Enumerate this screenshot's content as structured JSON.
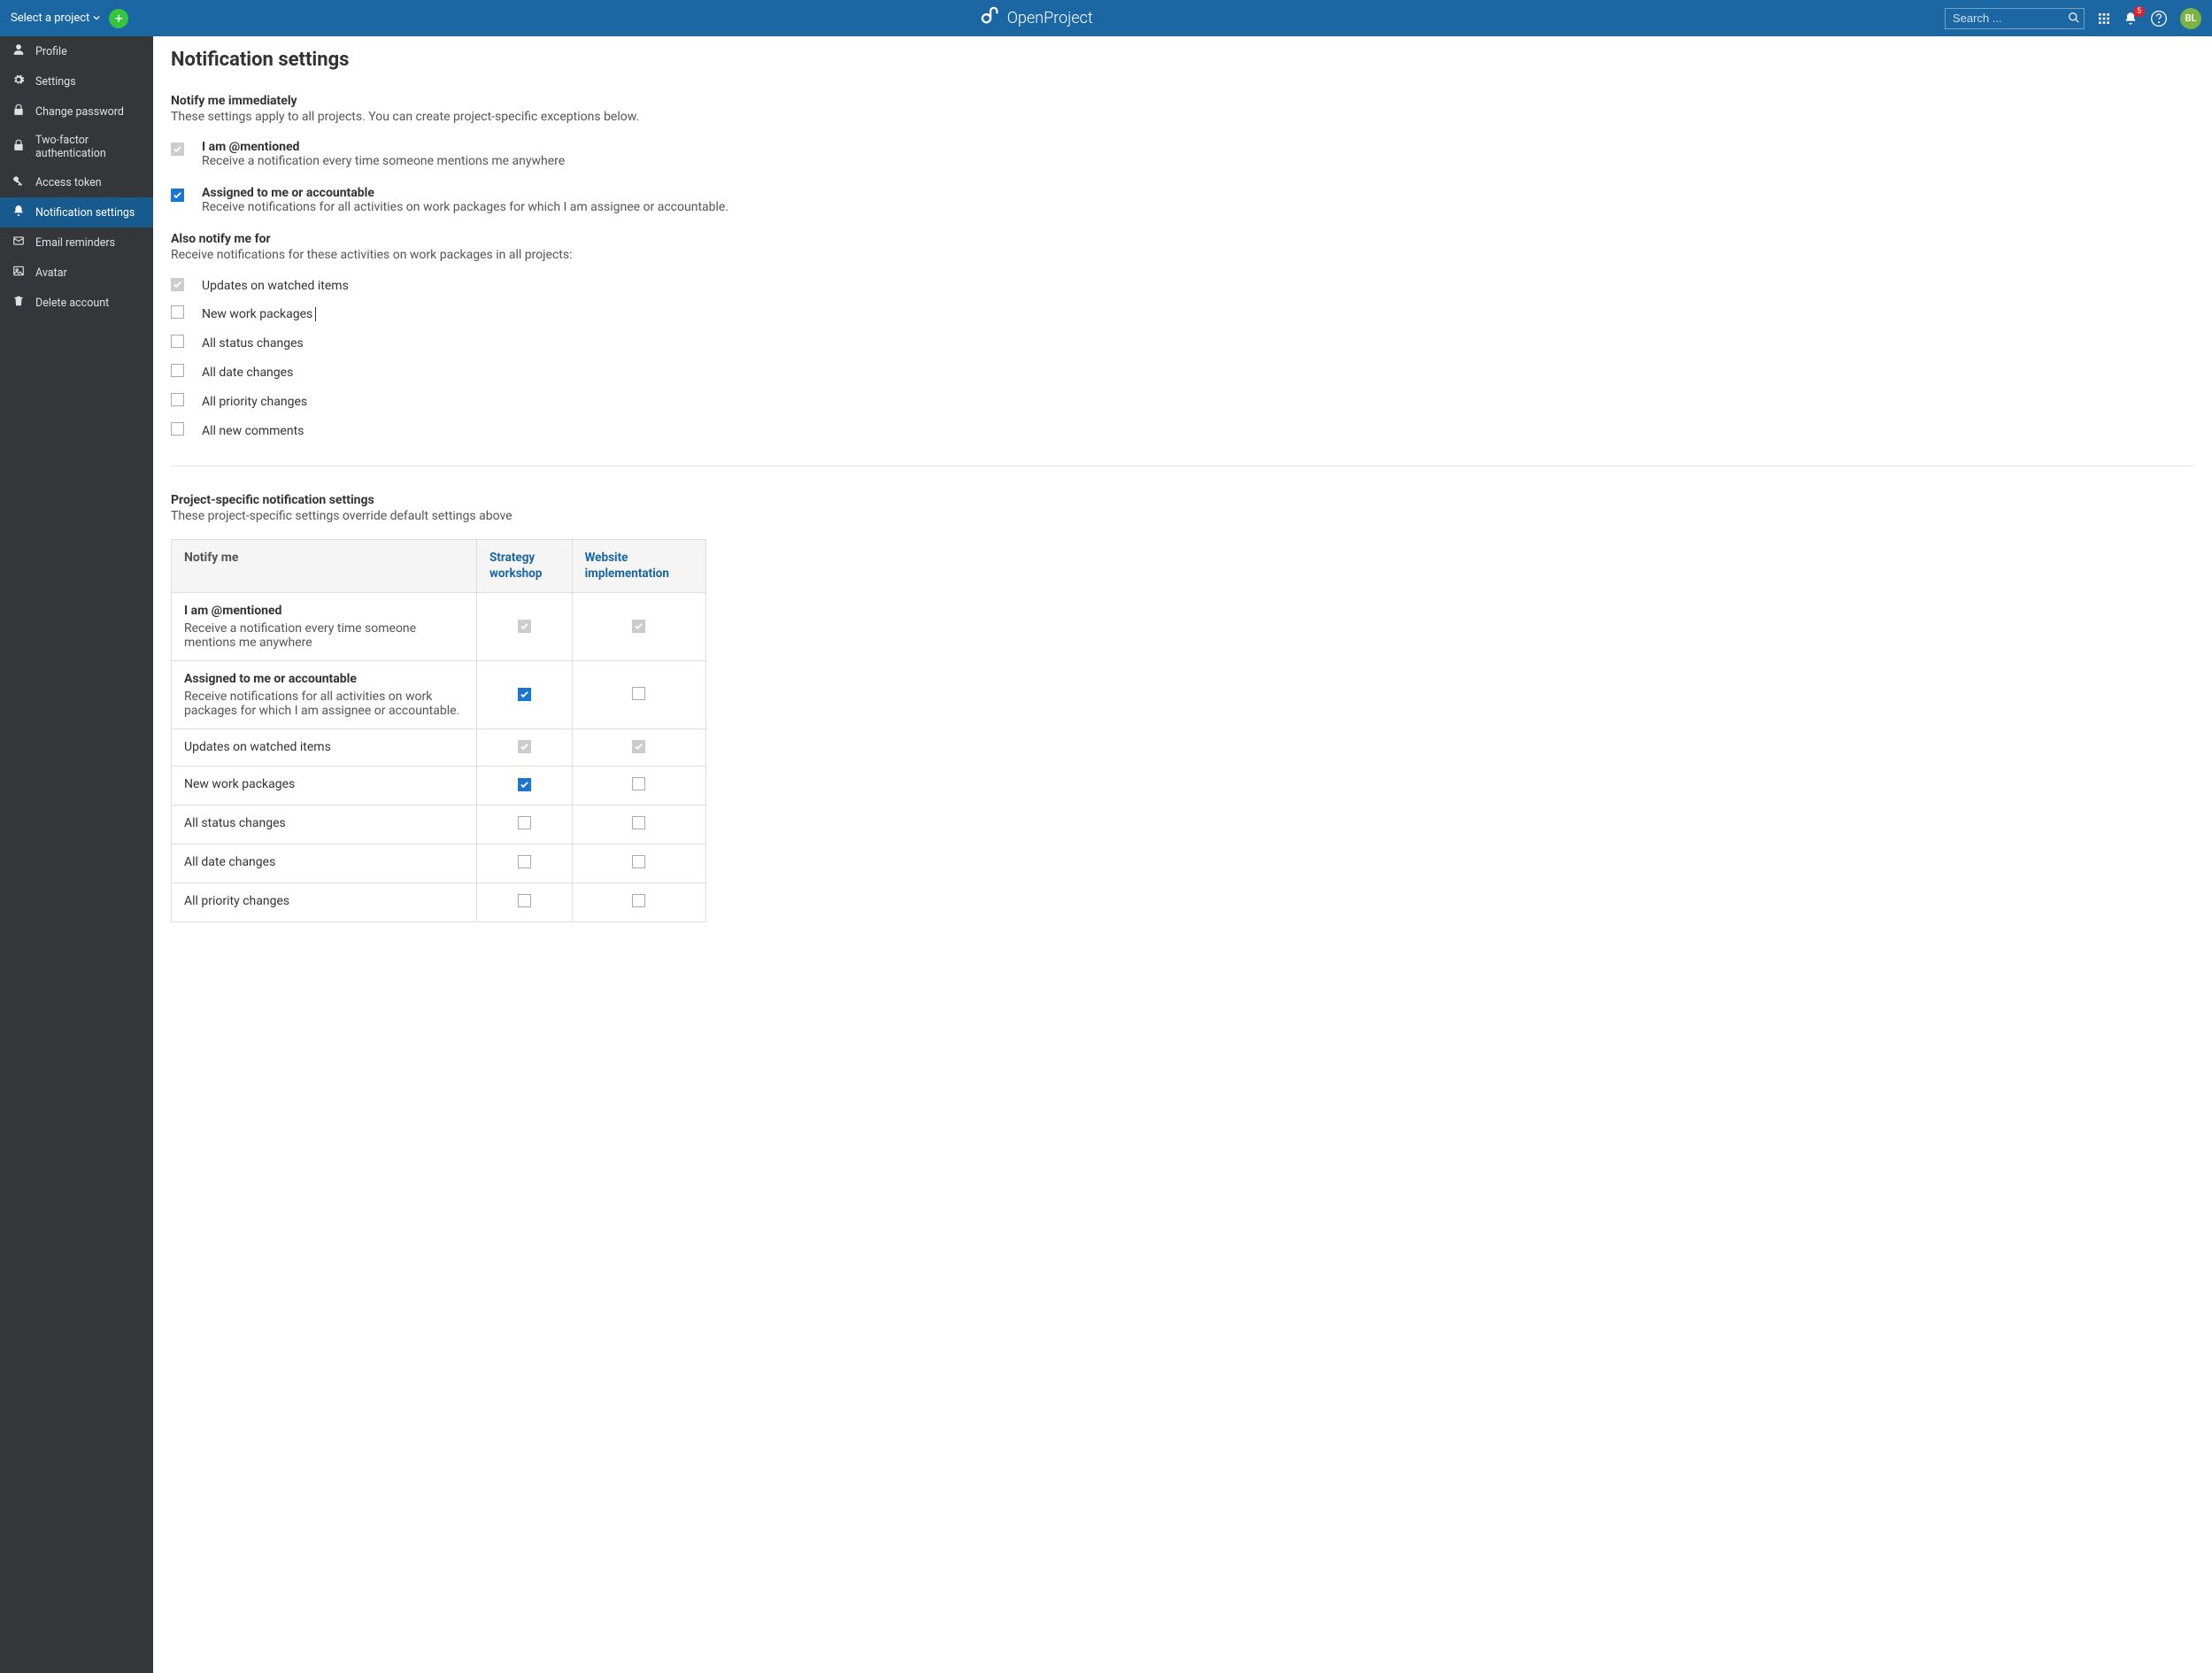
{
  "topbar": {
    "project_label": "Select a project",
    "search_placeholder": "Search ...",
    "brand": "OpenProject",
    "badge_count": "5",
    "avatar_initials": "BL"
  },
  "sidebar": {
    "items": [
      {
        "label": "Profile",
        "icon": "user"
      },
      {
        "label": "Settings",
        "icon": "gear"
      },
      {
        "label": "Change password",
        "icon": "lock"
      },
      {
        "label": "Two-factor authentication",
        "icon": "lock"
      },
      {
        "label": "Access token",
        "icon": "key"
      },
      {
        "label": "Notification settings",
        "icon": "bell",
        "active": true
      },
      {
        "label": "Email reminders",
        "icon": "mail"
      },
      {
        "label": "Avatar",
        "icon": "image"
      },
      {
        "label": "Delete account",
        "icon": "trash"
      }
    ]
  },
  "page": {
    "title": "Notification settings",
    "section1_title": "Notify me immediately",
    "section1_desc": "These settings apply to all projects. You can create project-specific exceptions below.",
    "opt_mentioned_title": "I am @mentioned",
    "opt_mentioned_desc": "Receive a notification every time someone mentions me anywhere",
    "opt_assigned_title": "Assigned to me or accountable",
    "opt_assigned_desc": "Receive notifications for all activities on work packages for which I am assignee or accountable.",
    "section2_title": "Also notify me for",
    "section2_desc": "Receive notifications for these activities on work packages in all projects:",
    "simple_opts": [
      {
        "label": "Updates on watched items",
        "checked": true,
        "disabled": true
      },
      {
        "label": "New work packages",
        "checked": false,
        "disabled": false,
        "cursor": true
      },
      {
        "label": "All status changes",
        "checked": false,
        "disabled": false
      },
      {
        "label": "All date changes",
        "checked": false,
        "disabled": false
      },
      {
        "label": "All priority changes",
        "checked": false,
        "disabled": false
      },
      {
        "label": "All new comments",
        "checked": false,
        "disabled": false
      }
    ],
    "section3_title": "Project-specific notification settings",
    "section3_desc": "These project-specific settings override default settings above",
    "table": {
      "header_notify": "Notify me",
      "projects": [
        "Strategy workshop",
        "Website implementation"
      ],
      "rows": [
        {
          "title": "I am @mentioned",
          "desc": "Receive a notification every time someone mentions me anywhere",
          "cells": [
            {
              "checked": true,
              "disabled": true
            },
            {
              "checked": true,
              "disabled": true
            }
          ]
        },
        {
          "title": "Assigned to me or accountable",
          "desc": "Receive notifications for all activities on work packages for which I am assignee or accountable.",
          "cells": [
            {
              "checked": true,
              "disabled": false
            },
            {
              "checked": false,
              "disabled": false
            }
          ]
        },
        {
          "title": "Updates on watched items",
          "desc": "",
          "cells": [
            {
              "checked": true,
              "disabled": true
            },
            {
              "checked": true,
              "disabled": true
            }
          ]
        },
        {
          "title": "New work packages",
          "desc": "",
          "cells": [
            {
              "checked": true,
              "disabled": false
            },
            {
              "checked": false,
              "disabled": false
            }
          ]
        },
        {
          "title": "All status changes",
          "desc": "",
          "cells": [
            {
              "checked": false,
              "disabled": false
            },
            {
              "checked": false,
              "disabled": false
            }
          ]
        },
        {
          "title": "All date changes",
          "desc": "",
          "cells": [
            {
              "checked": false,
              "disabled": false
            },
            {
              "checked": false,
              "disabled": false
            }
          ]
        },
        {
          "title": "All priority changes",
          "desc": "",
          "cells": [
            {
              "checked": false,
              "disabled": false
            },
            {
              "checked": false,
              "disabled": false
            }
          ]
        }
      ]
    }
  }
}
